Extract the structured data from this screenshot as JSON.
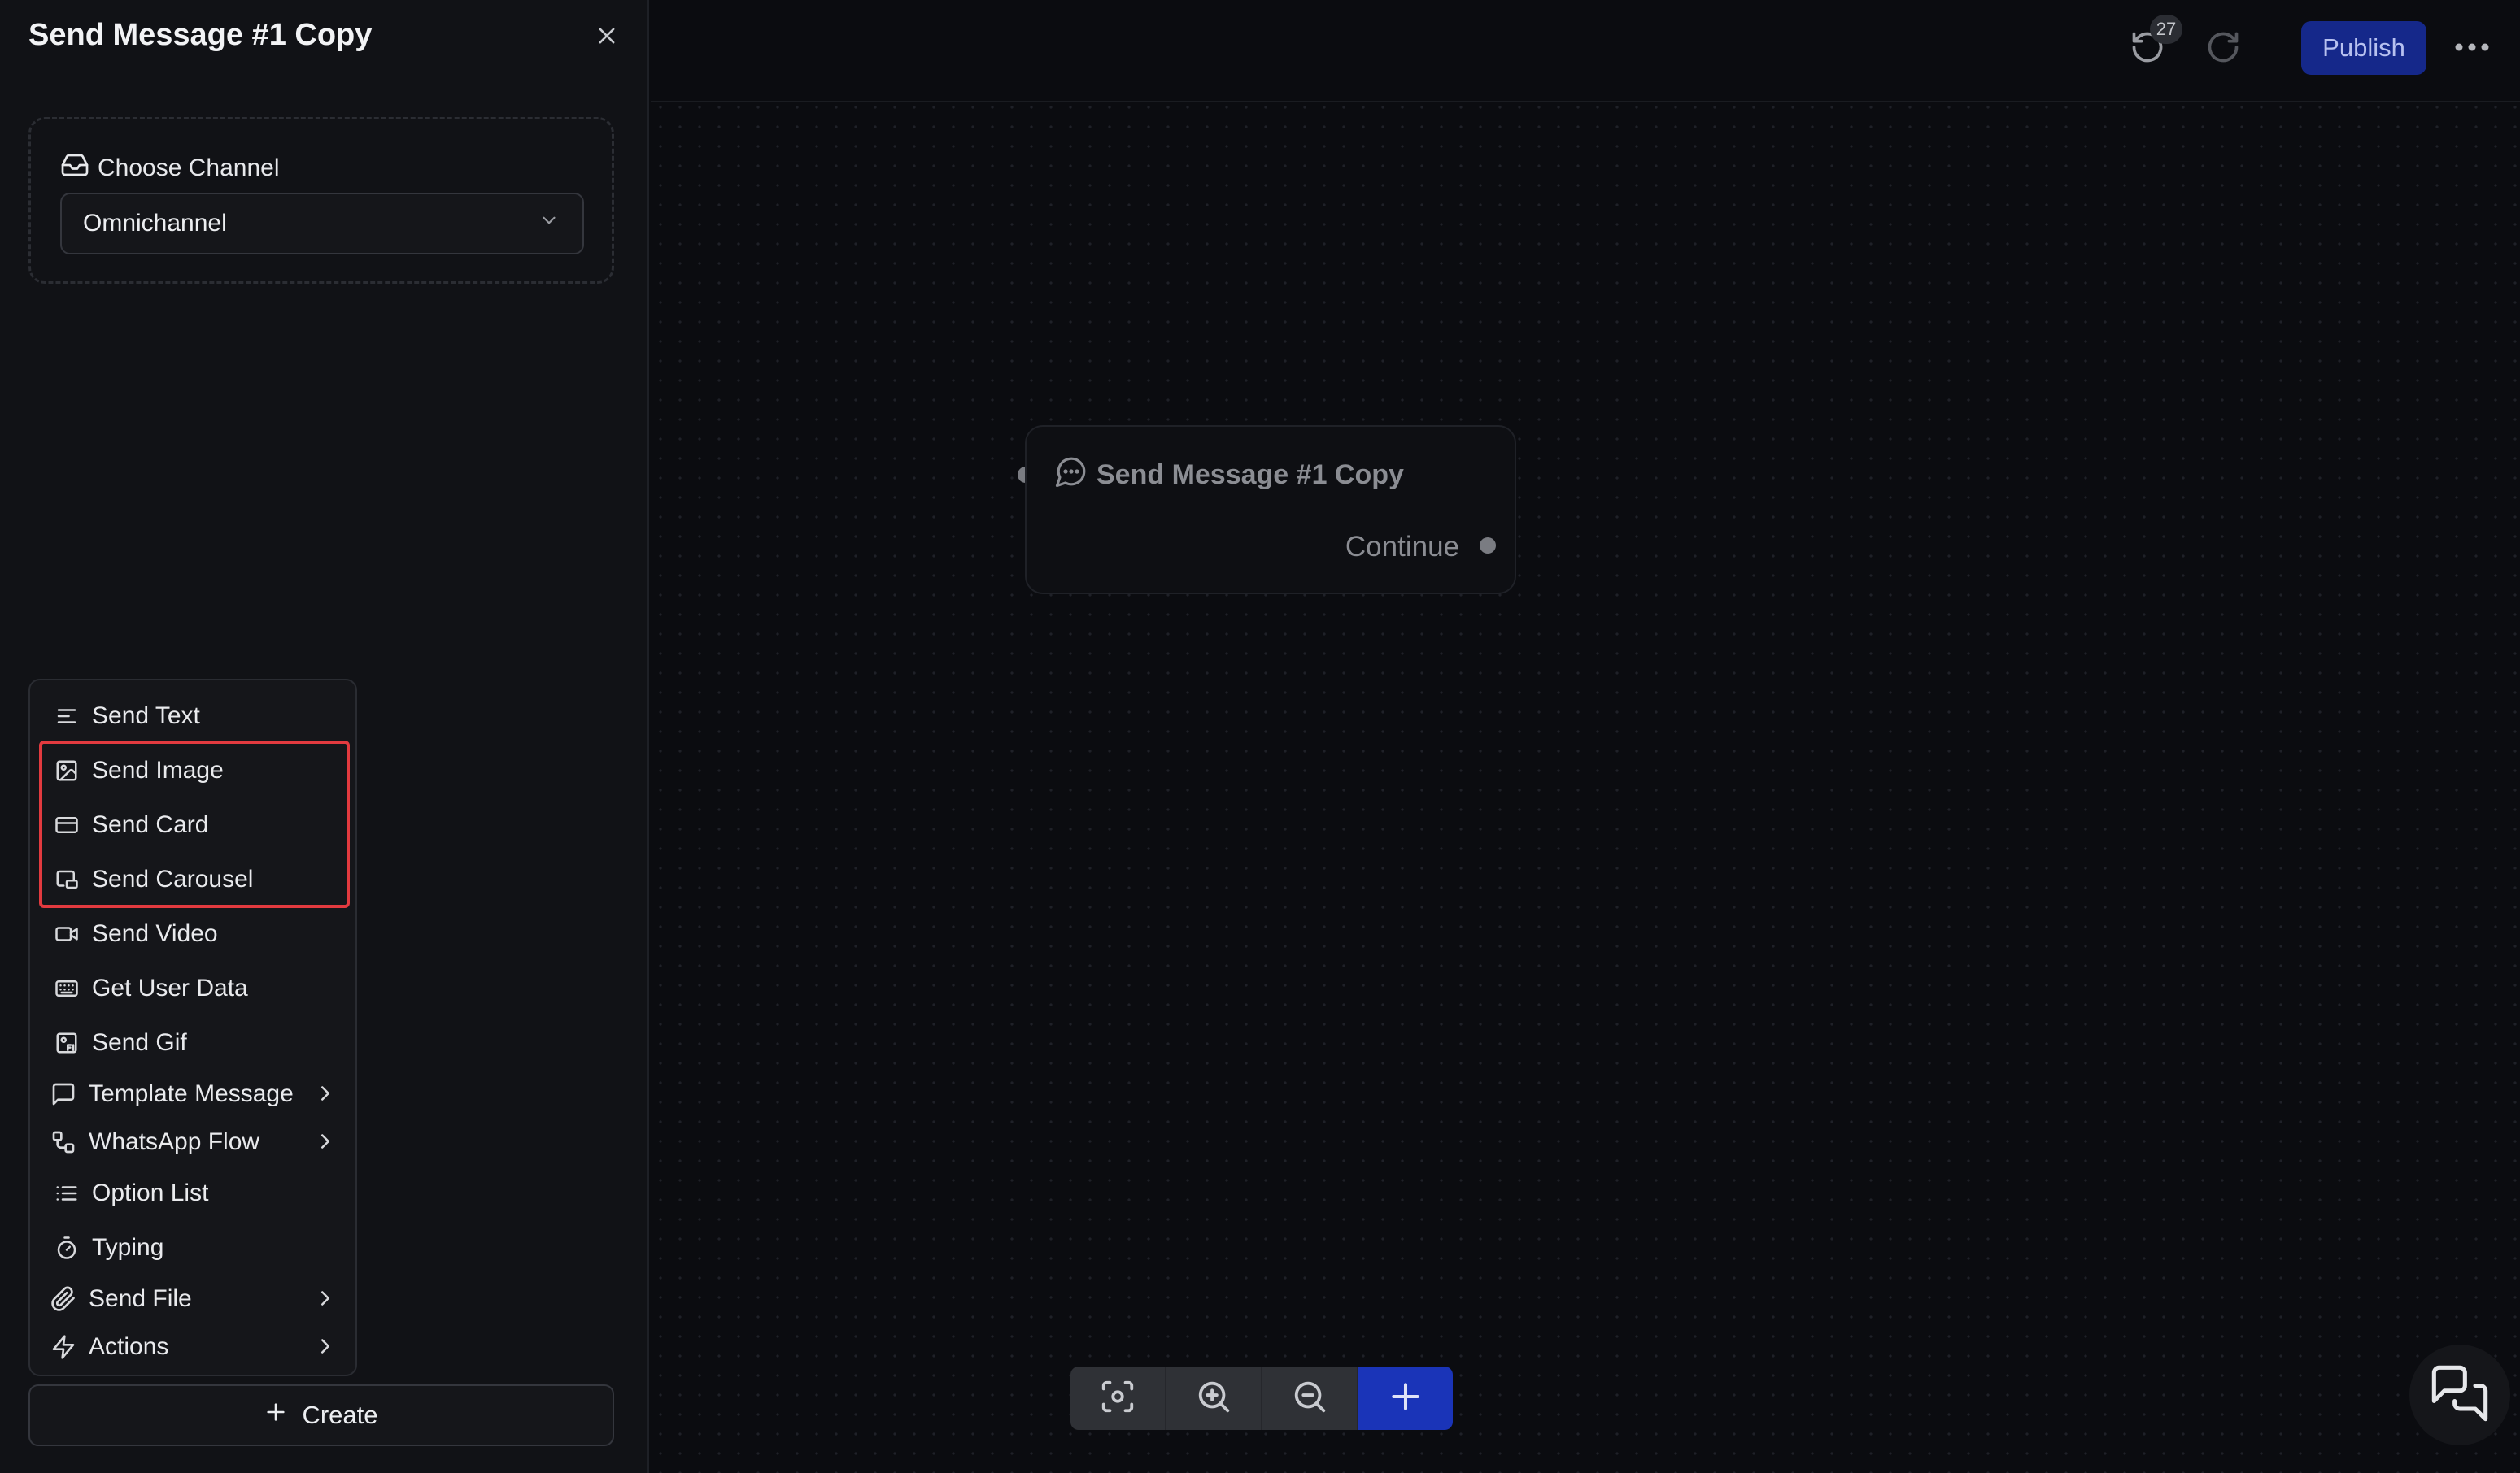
{
  "panel": {
    "title": "Send Message #1 Copy",
    "channel_label": "Choose Channel",
    "channel_value": "Omnichannel"
  },
  "menu": {
    "items": [
      {
        "label": "Send Text",
        "icon": "align-left-icon"
      },
      {
        "label": "Send Image",
        "icon": "image-icon"
      },
      {
        "label": "Send Card",
        "icon": "card-icon"
      },
      {
        "label": "Send Carousel",
        "icon": "carousel-icon"
      },
      {
        "label": "Send Video",
        "icon": "video-icon"
      },
      {
        "label": "Get User Data",
        "icon": "keyboard-icon"
      },
      {
        "label": "Send Gif",
        "icon": "gif-icon"
      },
      {
        "label": "Template Message",
        "icon": "message-square-icon",
        "submenu": true
      },
      {
        "label": "WhatsApp Flow",
        "icon": "flow-icon",
        "submenu": true
      },
      {
        "label": "Option List",
        "icon": "list-icon"
      },
      {
        "label": "Typing",
        "icon": "timer-icon"
      },
      {
        "label": "Send File",
        "icon": "paperclip-icon",
        "submenu": true
      },
      {
        "label": "Actions",
        "icon": "zap-icon",
        "submenu": true
      }
    ]
  },
  "create_label": "Create",
  "topbar": {
    "undo_count": "27",
    "publish_label": "Publish"
  },
  "node": {
    "title": "Send Message #1 Copy",
    "output_label": "Continue"
  },
  "colors": {
    "highlight": "#e23a3f",
    "publish_bg": "#15288a",
    "add_bg": "#1a34b8"
  }
}
